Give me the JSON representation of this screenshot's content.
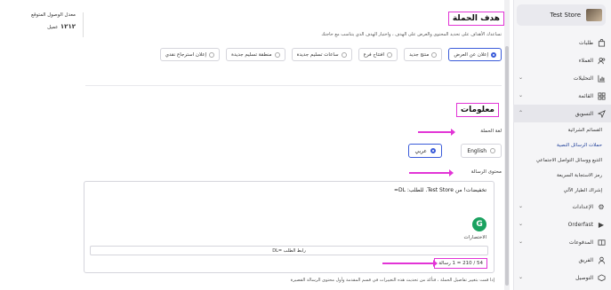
{
  "store": {
    "name": "Test Store"
  },
  "sidebar": {
    "items": [
      {
        "label": "طلبات",
        "icon": "bag-icon",
        "has_chevron": false
      },
      {
        "label": "العملاء",
        "icon": "users-icon",
        "has_chevron": false
      },
      {
        "label": "التحليلات",
        "icon": "chart-icon",
        "has_chevron": true
      },
      {
        "label": "القائمة",
        "icon": "grid-icon",
        "has_chevron": true
      },
      {
        "label": "التسويق",
        "icon": "send-icon",
        "has_chevron": true,
        "active": true
      }
    ],
    "marketing_sub": [
      {
        "label": "القسائم الشرائية"
      },
      {
        "label": "حملات الرسائل النصية",
        "active": true
      },
      {
        "label": "التتبع ووسائل التواصل الاجتماعي"
      },
      {
        "label": "رمز الاستجابة السريعة"
      },
      {
        "label": "إشراك الطيار الآلي"
      }
    ],
    "items_after": [
      {
        "label": "الإعدادات",
        "icon": "gear-icon",
        "has_chevron": true
      },
      {
        "label": "Orderfast",
        "icon": "play-icon",
        "has_chevron": true
      },
      {
        "label": "المدفوعات",
        "icon": "wallet-icon",
        "has_chevron": true
      },
      {
        "label": "الفريق",
        "icon": "person-icon",
        "has_chevron": false
      },
      {
        "label": "التوصيل",
        "icon": "truck-icon",
        "has_chevron": true
      }
    ]
  },
  "reach": {
    "label": "معدل الوصول المتوقع",
    "value": "١٢١٢",
    "unit": "عميل"
  },
  "goal_section": {
    "title": "هدف الحملة",
    "hint": "تساعدك الأهداف على تحديد المحتوى والعرض على الهدف ، واختيار الهدف الذي يتناسب مع حاجتك",
    "options": [
      {
        "label": "إعلان عن العرض",
        "selected": true
      },
      {
        "label": "منتج جديد",
        "selected": false
      },
      {
        "label": "افتتاح فرع",
        "selected": false
      },
      {
        "label": "ساعات تسليم جديدة",
        "selected": false
      },
      {
        "label": "منطقة تسليم جديدة",
        "selected": false
      },
      {
        "label": "إعلان استرجاع نقدي",
        "selected": false
      }
    ]
  },
  "info_section": {
    "title": "معلومات",
    "campaign_language_label": "لغة الحملة",
    "languages": [
      {
        "label": "عربي",
        "selected": true
      },
      {
        "label": "English",
        "selected": false
      }
    ],
    "message_content_label": "محتوى الرسالة",
    "message_text": "تخفيضات! من Test Store. للطلب: DL=",
    "shortcuts_label": "الاختصارات",
    "order_link_label": "رابط الطلب =DL",
    "counter": "54 / 210 = 1 رسالة",
    "footnote": "إذا قمت بتغيير تفاصيل الحملة ، فتأكد من تحديث هذه التغييرات في قسم المقدمة وأول محتوى الرسالة القصيرة"
  },
  "colors": {
    "accent": "#3a5bd9",
    "highlight": "#e234d6"
  }
}
